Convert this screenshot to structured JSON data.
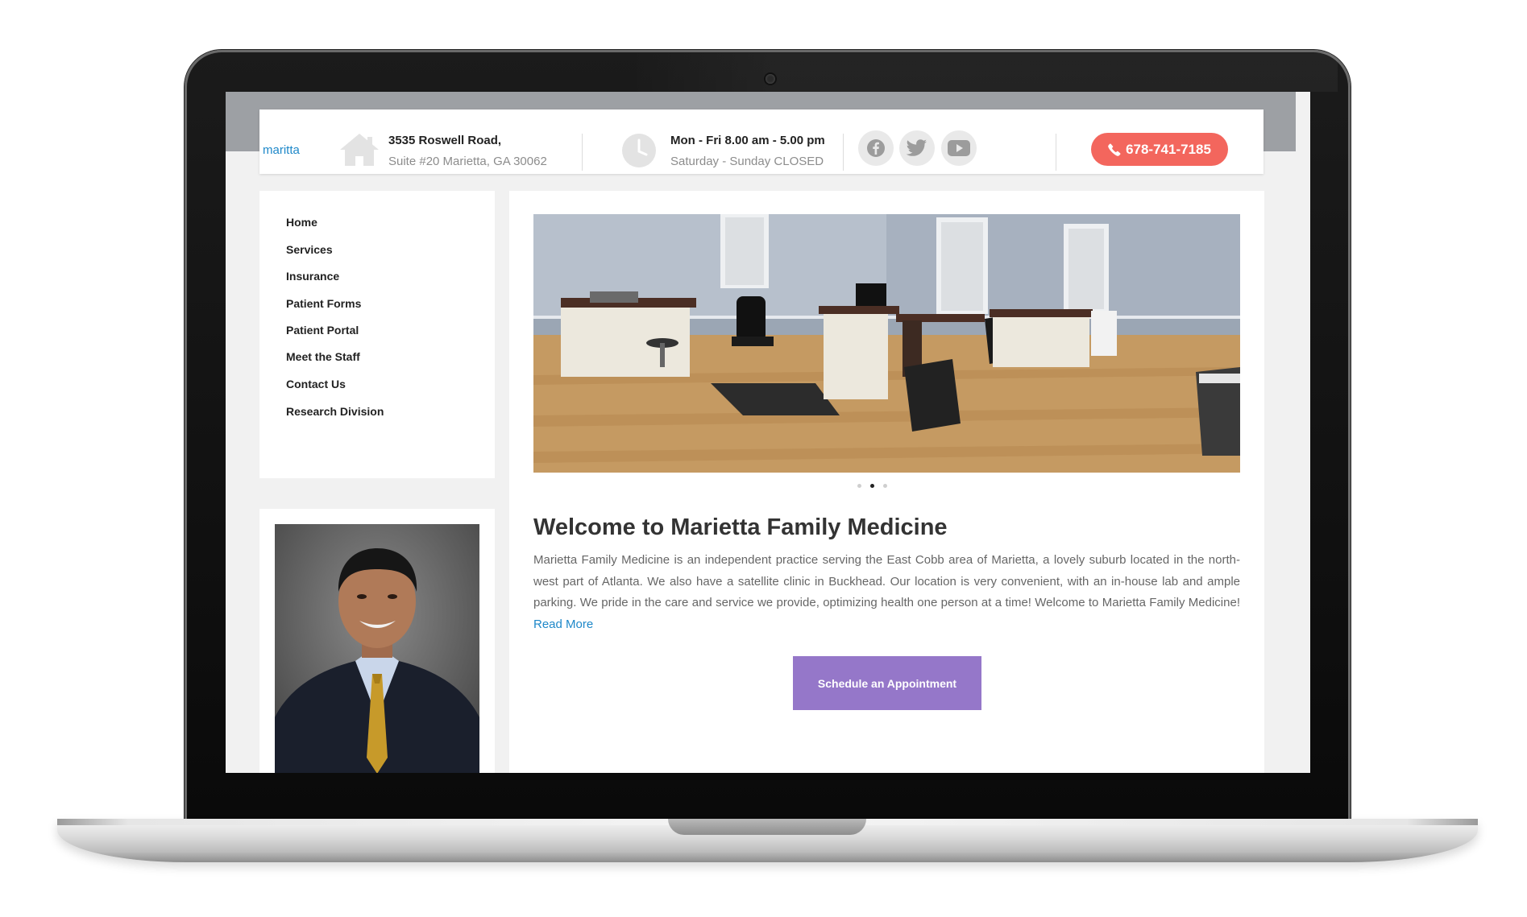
{
  "header": {
    "logo_text": "maritta",
    "address_line1": "3535 Roswell Road,",
    "address_line2": "Suite #20 Marietta, GA 30062",
    "hours_line1": "Mon - Fri 8.00 am - 5.00 pm",
    "hours_line2": "Saturday - Sunday CLOSED",
    "social_icons": [
      "facebook-icon",
      "twitter-icon",
      "youtube-icon"
    ],
    "phone": "678-741-7185",
    "phone_color": "#f3665d"
  },
  "sidebar": {
    "menu": [
      {
        "label": "Home"
      },
      {
        "label": "Services"
      },
      {
        "label": "Insurance"
      },
      {
        "label": "Patient Forms"
      },
      {
        "label": "Patient Portal"
      },
      {
        "label": "Meet the Staff"
      },
      {
        "label": "Contact Us"
      },
      {
        "label": "Research Division"
      }
    ]
  },
  "main": {
    "slider": {
      "active_index": 1,
      "slide_count": 3
    },
    "title": "Welcome to Marietta Family Medicine",
    "intro": "Marietta Family Medicine is an independent practice serving the East Cobb area of Marietta, a lovely suburb located in the north-west part of Atlanta. We also have a satellite clinic in Buckhead. Our location is very convenient, with an in-house lab and ample parking. We pride in the care and service we provide, optimizing health one person at a time! Welcome to Marietta Family Medicine!",
    "read_more": "Read More",
    "appointment_button": "Schedule an Appointment",
    "link_color": "#1e88c9",
    "button_color": "#9577c9"
  }
}
